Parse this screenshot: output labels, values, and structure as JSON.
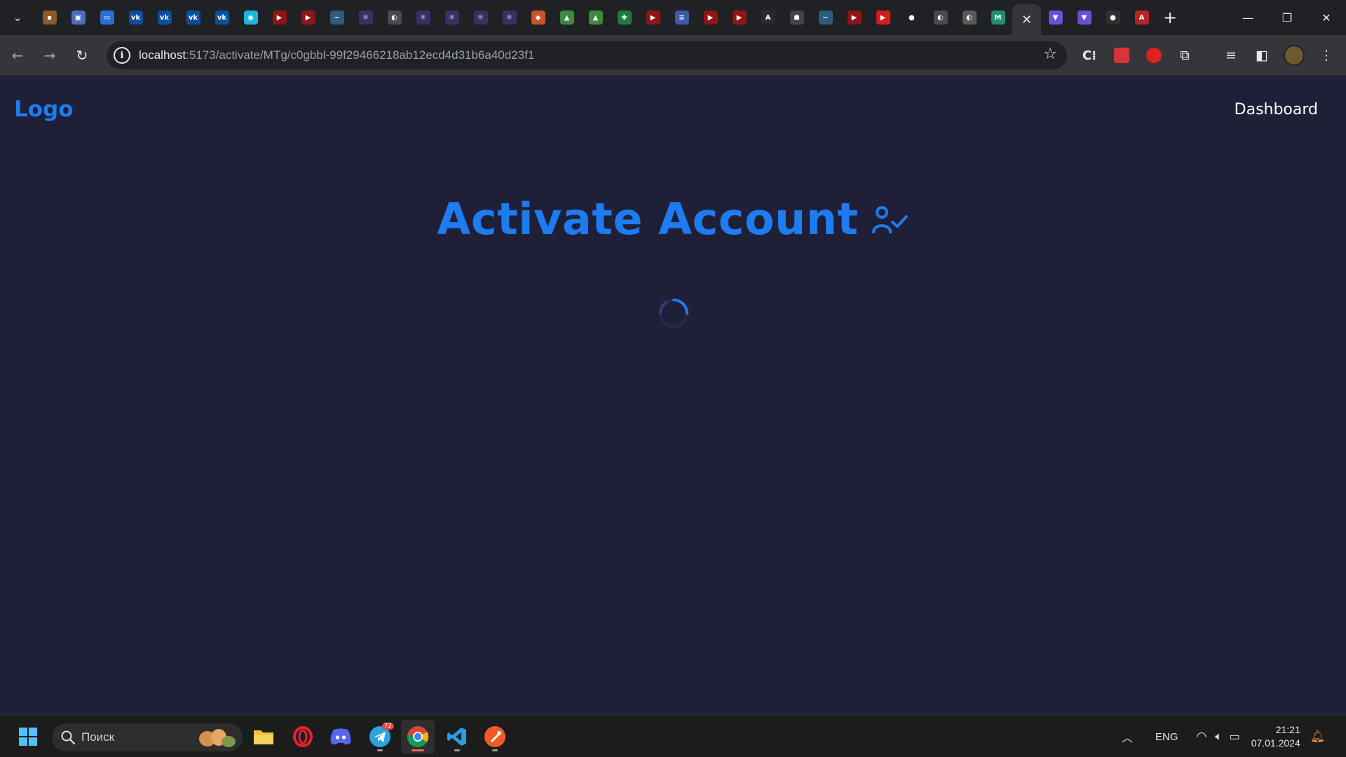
{
  "browser": {
    "tabs": [
      {
        "icon": "orange-square-icon",
        "color": "#8a5a2b",
        "glyph": "▪"
      },
      {
        "icon": "app-icon",
        "color": "#4b6fbf",
        "glyph": "▣"
      },
      {
        "icon": "chat-icon",
        "color": "#2a6fd6",
        "glyph": "▭"
      },
      {
        "icon": "vk-icon",
        "color": "#0a4f9e",
        "glyph": "vk"
      },
      {
        "icon": "vk-icon",
        "color": "#0a4f9e",
        "glyph": "vk"
      },
      {
        "icon": "vk-icon",
        "color": "#0a4f9e",
        "glyph": "vk"
      },
      {
        "icon": "vk-icon",
        "color": "#0a4f9e",
        "glyph": "vk"
      },
      {
        "icon": "cyan-app-icon",
        "color": "#19b6d8",
        "glyph": "◉"
      },
      {
        "icon": "youtube-icon",
        "color": "#8e1515",
        "glyph": "▶"
      },
      {
        "icon": "youtube-icon",
        "color": "#8e1515",
        "glyph": "▶"
      },
      {
        "icon": "swirl-icon",
        "color": "#2d5b7e",
        "glyph": "∽"
      },
      {
        "icon": "triad-icon",
        "color": "#3b2e63",
        "glyph": "⚛"
      },
      {
        "icon": "globe-icon",
        "color": "#4a4a4a",
        "glyph": "◐"
      },
      {
        "icon": "triad-icon",
        "color": "#3b2e63",
        "glyph": "⚛"
      },
      {
        "icon": "triad-icon",
        "color": "#3b2e63",
        "glyph": "⚛"
      },
      {
        "icon": "triad-icon",
        "color": "#3b2e63",
        "glyph": "⚛"
      },
      {
        "icon": "triad-icon",
        "color": "#3b2e63",
        "glyph": "⚛"
      },
      {
        "icon": "gitlab-icon",
        "color": "#c9532a",
        "glyph": "◆"
      },
      {
        "icon": "drive-icon",
        "color": "#3b8a3f",
        "glyph": "▲"
      },
      {
        "icon": "drive-icon",
        "color": "#3b8a3f",
        "glyph": "▲"
      },
      {
        "icon": "sheets-icon",
        "color": "#1f7a3d",
        "glyph": "✚"
      },
      {
        "icon": "youtube-icon",
        "color": "#8e1515",
        "glyph": "▶"
      },
      {
        "icon": "docs-icon",
        "color": "#3b5aa8",
        "glyph": "≡"
      },
      {
        "icon": "youtube-icon",
        "color": "#8e1515",
        "glyph": "▶"
      },
      {
        "icon": "youtube-icon",
        "color": "#8e1515",
        "glyph": "▶"
      },
      {
        "icon": "letter-a-icon",
        "color": "#2a2a2a",
        "glyph": "A"
      },
      {
        "icon": "robot-icon",
        "color": "#444444",
        "glyph": "☗"
      },
      {
        "icon": "swirl-icon",
        "color": "#2d5b7e",
        "glyph": "∽"
      },
      {
        "icon": "youtube-icon",
        "color": "#8e1515",
        "glyph": "▶"
      },
      {
        "icon": "youtube-icon",
        "color": "#d41c1c",
        "glyph": "▶"
      },
      {
        "icon": "github-icon",
        "color": "#202124",
        "glyph": "●"
      },
      {
        "icon": "globe-icon",
        "color": "#4a4a4a",
        "glyph": "◐"
      },
      {
        "icon": "globe-icon",
        "color": "#5a5a5a",
        "glyph": "◐"
      },
      {
        "icon": "mail-icon",
        "color": "#1f8f6f",
        "glyph": "M"
      },
      {
        "icon": "close-icon",
        "color": "#35363a",
        "glyph": "✕",
        "active": true
      },
      {
        "icon": "vite-icon",
        "color": "#6d4fd6",
        "glyph": "▼"
      },
      {
        "icon": "vite-icon",
        "color": "#6d4fd6",
        "glyph": "▼"
      },
      {
        "icon": "github-icon",
        "color": "#303030",
        "glyph": "●"
      },
      {
        "icon": "letter-a-icon",
        "color": "#b82323",
        "glyph": "A"
      }
    ],
    "url": {
      "host": "localhost",
      "path": ":5173/activate/MTg/c0gbbl-99f29466218ab12ecd4d31b6a40d23f1"
    }
  },
  "page": {
    "logo": "Logo",
    "nav_dashboard": "Dashboard",
    "title": "Activate Account",
    "accent": "#1e7bf0",
    "background": "#1f1f38"
  },
  "taskbar": {
    "search_placeholder": "Поиск",
    "telegram_badge": "72",
    "language": "ENG",
    "time": "21:21",
    "date": "07.01.2024"
  }
}
